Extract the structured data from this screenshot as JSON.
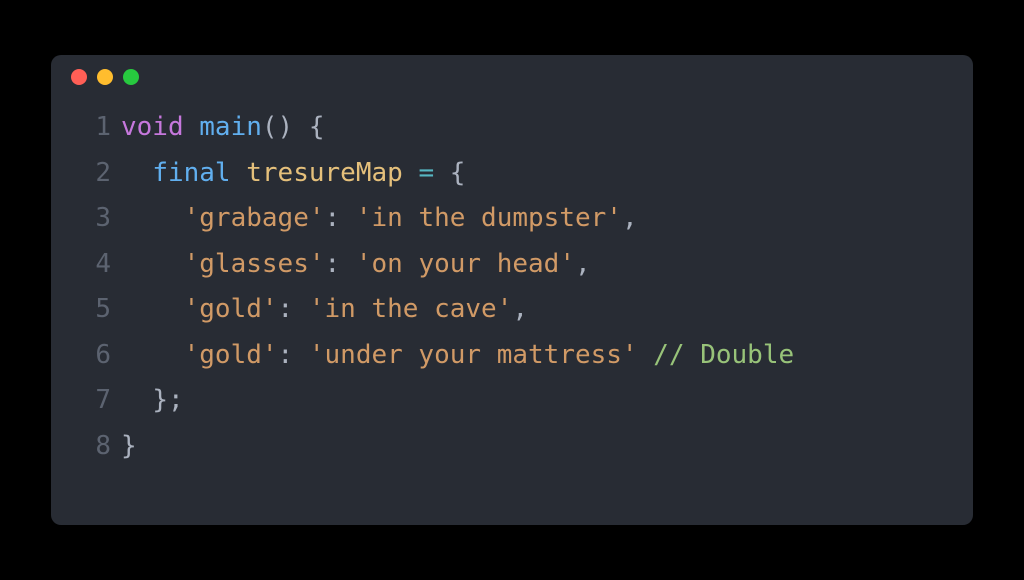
{
  "titlebar": {
    "buttons": [
      "close",
      "minimize",
      "zoom"
    ]
  },
  "code": {
    "lines": [
      {
        "no": "1",
        "tokens": {
          "t0": "void",
          "t1": " ",
          "t2": "main",
          "t3": "() {",
          "full": "void main() {"
        }
      },
      {
        "no": "2",
        "tokens": {
          "indent": "  ",
          "t0": "final",
          "t1": " ",
          "t2": "tresureMap",
          "t3": " ",
          "t4": "=",
          "t5": " {",
          "full": "  final tresureMap = {"
        }
      },
      {
        "no": "3",
        "tokens": {
          "indent": "    ",
          "k": "'grabage'",
          "sep": ": ",
          "v": "'in the dumpster'",
          "end": ","
        }
      },
      {
        "no": "4",
        "tokens": {
          "indent": "    ",
          "k": "'glasses'",
          "sep": ": ",
          "v": "'on your head'",
          "end": ","
        }
      },
      {
        "no": "5",
        "tokens": {
          "indent": "    ",
          "k": "'gold'",
          "sep": ": ",
          "v": "'in the cave'",
          "end": ","
        }
      },
      {
        "no": "6",
        "tokens": {
          "indent": "    ",
          "k": "'gold'",
          "sep": ": ",
          "v": "'under your mattress'",
          "sp": " ",
          "comment": "// Double"
        }
      },
      {
        "no": "7",
        "tokens": {
          "indent": "  ",
          "end": "};"
        }
      },
      {
        "no": "8",
        "tokens": {
          "end": "}"
        }
      }
    ]
  }
}
